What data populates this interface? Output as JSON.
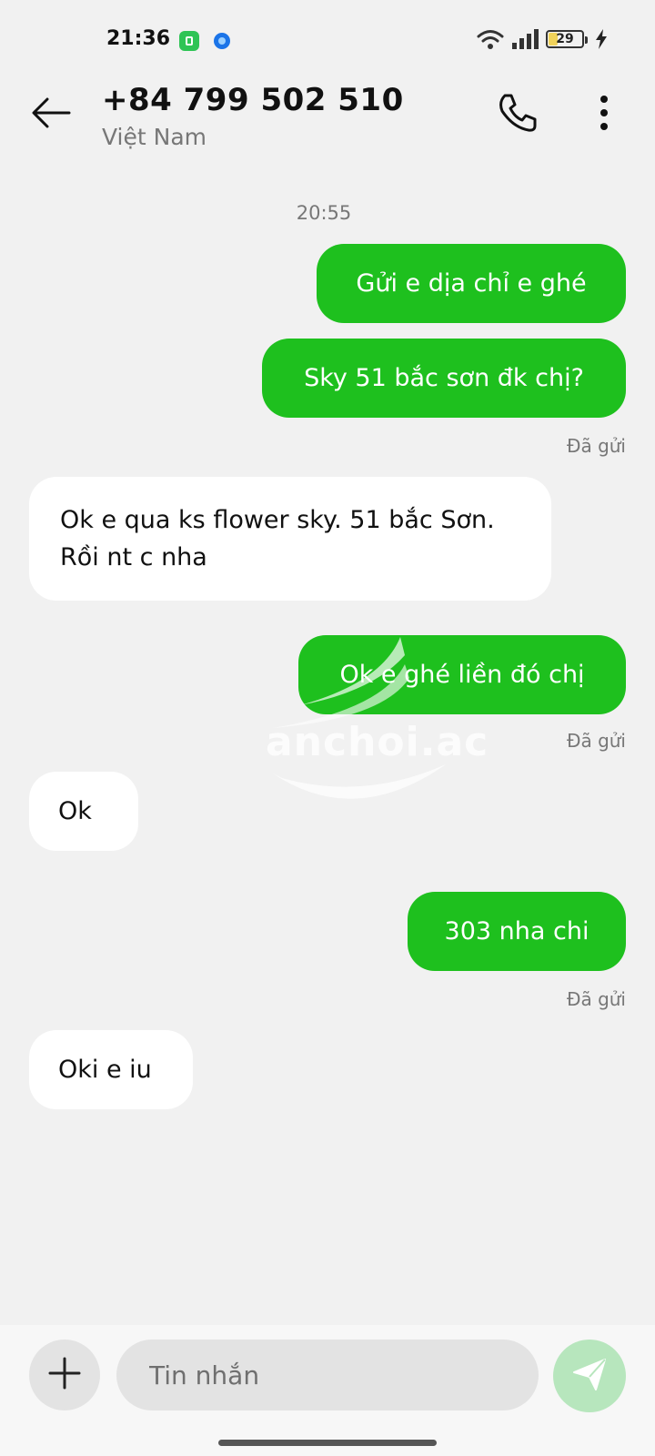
{
  "status_bar": {
    "time": "21:36",
    "battery_level": "29",
    "battery_fraction": 0.29,
    "icons": [
      "wifi-icon",
      "signal-icon",
      "battery-icon",
      "charging-icon"
    ]
  },
  "header": {
    "contact_number": "+84 799 502 510",
    "contact_country": "Việt Nam",
    "icons": [
      "back-arrow-icon",
      "phone-icon",
      "more-vert-icon"
    ]
  },
  "conversation": {
    "time_separator": "20:55",
    "messages": [
      {
        "direction": "outgoing",
        "text": "Gửi e dịa chỉ e ghé"
      },
      {
        "direction": "outgoing",
        "text": "Sky 51 bắc sơn đk chị?",
        "status": "Đã gửi"
      },
      {
        "direction": "incoming",
        "text": "Ok e qua ks flower sky. 51 bắc Sơn. Rồi nt c nha"
      },
      {
        "direction": "outgoing",
        "text": "Ok e ghé liền đó chị",
        "status": "Đã gửi"
      },
      {
        "direction": "incoming",
        "text": "Ok"
      },
      {
        "direction": "outgoing",
        "text": "303 nha chi",
        "status": "Đã gửi"
      },
      {
        "direction": "incoming",
        "text": "Oki e iu"
      }
    ]
  },
  "watermark": {
    "text": "anchoi.ac"
  },
  "composer": {
    "placeholder": "Tin nhắn",
    "icons": [
      "plus-icon",
      "send-icon"
    ]
  },
  "colors": {
    "outgoing_bubble": "#1ec01e",
    "incoming_bubble": "#ffffff",
    "background": "#f1f1f1",
    "send_button": "#b7e6bd"
  }
}
